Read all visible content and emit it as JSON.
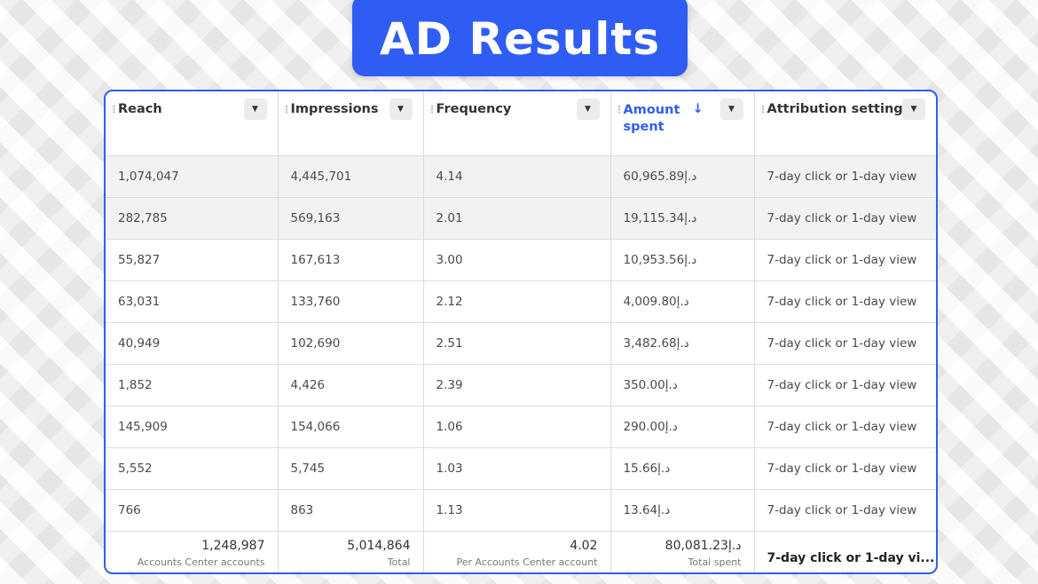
{
  "title": "AD Results",
  "icons": {
    "column_menu": "caret-down-icon",
    "sort": "arrow-down-icon",
    "grip": "drag-handle-icon"
  },
  "colors": {
    "accent": "#2f5df4",
    "highlight_row": "#f1f3f1"
  },
  "columns": [
    {
      "label": "Reach"
    },
    {
      "label": "Impressions"
    },
    {
      "label": "Frequency"
    },
    {
      "label": "Amount spent",
      "sort_indicator": "↓"
    },
    {
      "label": "Attribution setting"
    }
  ],
  "rows": [
    [
      "1,074,047",
      "4,445,701",
      "4.14",
      "60,965.89د.إ",
      "7-day click or 1-day view"
    ],
    [
      "282,785",
      "569,163",
      "2.01",
      "19,115.34د.إ",
      "7-day click or 1-day view"
    ],
    [
      "55,827",
      "167,613",
      "3.00",
      "10,953.56د.إ",
      "7-day click or 1-day view"
    ],
    [
      "63,031",
      "133,760",
      "2.12",
      "4,009.80د.إ",
      "7-day click or 1-day view"
    ],
    [
      "40,949",
      "102,690",
      "2.51",
      "3,482.68د.إ",
      "7-day click or 1-day view"
    ],
    [
      "1,852",
      "4,426",
      "2.39",
      "350.00د.إ",
      "7-day click or 1-day view"
    ],
    [
      "145,909",
      "154,066",
      "1.06",
      "290.00د.إ",
      "7-day click or 1-day view"
    ],
    [
      "5,552",
      "5,745",
      "1.03",
      "15.66د.إ",
      "7-day click or 1-day view"
    ],
    [
      "766",
      "863",
      "1.13",
      "13.64د.إ",
      "7-day click or 1-day view"
    ]
  ],
  "totals": {
    "reach": {
      "value": "1,248,987",
      "sub": "Accounts Center accounts"
    },
    "impressions": {
      "value": "5,014,864",
      "sub": "Total"
    },
    "frequency": {
      "value": "4.02",
      "sub": "Per Accounts Center account"
    },
    "amount": {
      "value": "80,081.23د.إ",
      "sub": "Total spent"
    },
    "attribution": "7-day click or 1-day vi..."
  }
}
